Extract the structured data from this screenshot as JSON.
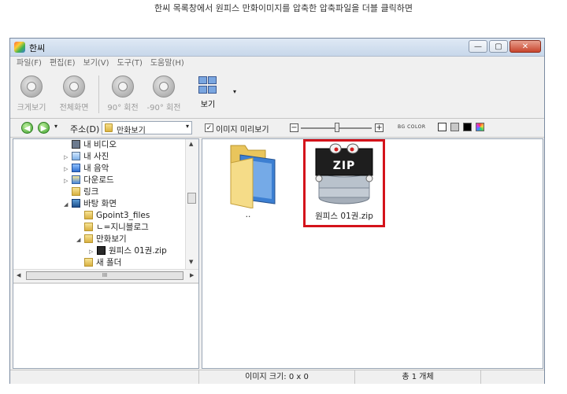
{
  "caption": "한씨 목록창에서 원피스 만화이미지를 압축한 압축파일을 더블 클릭하면",
  "window": {
    "title": "한씨",
    "buttons": {
      "minimize": "—",
      "maximize": "▢",
      "close": "✕"
    }
  },
  "menu": [
    "파일(F)",
    "편집(E)",
    "보기(V)",
    "도구(T)",
    "도움말(H)"
  ],
  "toolbar": {
    "buttons": [
      {
        "label": "크게보기",
        "enabled": false
      },
      {
        "label": "전체화면",
        "enabled": false
      },
      {
        "label": "90° 회전",
        "enabled": false
      },
      {
        "label": "-90° 회전",
        "enabled": false
      },
      {
        "label": "보기",
        "enabled": true
      }
    ],
    "dropdown": "▾"
  },
  "address": {
    "back": "◀",
    "forward": "▶",
    "history": "▾",
    "label": "주소(D)",
    "value": "만화보기",
    "drop": "▾"
  },
  "preview_option": {
    "label": "이미지 미리보기",
    "checked": true,
    "check_mark": "✓"
  },
  "zoom": {
    "minus": "−",
    "plus": "+",
    "level": 0.55
  },
  "background": {
    "label": "BG COLOR",
    "swatches": [
      "#ffffff",
      "#c8c8c8",
      "#000000",
      "multicolor"
    ],
    "selected": "#ffffff"
  },
  "tree": {
    "items": [
      {
        "label": "내 비디오",
        "icon": "video",
        "arrow": ""
      },
      {
        "label": "내 사진",
        "icon": "photo",
        "arrow": "▷"
      },
      {
        "label": "내 음악",
        "icon": "music",
        "arrow": "▷"
      },
      {
        "label": "다운로드",
        "icon": "download",
        "arrow": "▷"
      },
      {
        "label": "링크",
        "icon": "link",
        "arrow": ""
      },
      {
        "label": "바탕 화면",
        "icon": "desktop",
        "arrow": "◢"
      },
      {
        "label": "Gpoint3_files",
        "icon": "folder",
        "arrow": ""
      },
      {
        "label": "ㄴ=지니블로그",
        "icon": "folder",
        "arrow": ""
      },
      {
        "label": "만화보기",
        "icon": "folder",
        "arrow": "◢"
      },
      {
        "label": "원피스 01권.zip",
        "icon": "zip",
        "arrow": "▷"
      },
      {
        "label": "새 폴더",
        "icon": "folder",
        "arrow": ""
      }
    ],
    "hscroll_label": "III",
    "scroll_up": "▲",
    "scroll_down": "▼",
    "scroll_left": "◀",
    "scroll_right": "▶"
  },
  "files": [
    {
      "name": "..",
      "type": "parent-folder"
    },
    {
      "name": "원피스 01권.zip",
      "type": "zip",
      "badge": "ZIP",
      "selected": true
    }
  ],
  "status": {
    "left": "",
    "image_size": "이미지 크기: 0 x 0",
    "count": "총 1 개체"
  }
}
